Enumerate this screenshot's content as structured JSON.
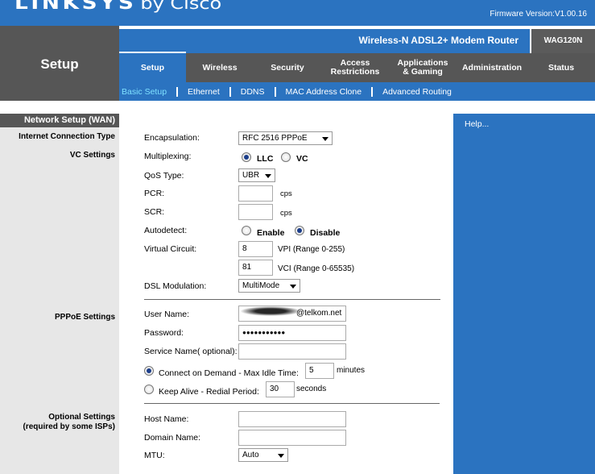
{
  "brand": {
    "logo": "LINKSYS",
    "by": "by Cisco",
    "firmware": "Firmware Version:V1.00.16"
  },
  "header": {
    "section_title": "Setup",
    "model_name": "Wireless-N ADSL2+ Modem Router",
    "model_id": "WAG120N"
  },
  "tabs": [
    {
      "label": "Setup",
      "active": true
    },
    {
      "label": "Wireless"
    },
    {
      "label": "Security"
    },
    {
      "label": "Access Restrictions"
    },
    {
      "label": "Applications & Gaming"
    },
    {
      "label": "Administration"
    },
    {
      "label": "Status"
    }
  ],
  "subnav": [
    {
      "label": "Basic Setup",
      "active": true
    },
    {
      "label": "Ethernet"
    },
    {
      "label": "DDNS"
    },
    {
      "label": "MAC Address Clone"
    },
    {
      "label": "Advanced Routing"
    }
  ],
  "left": {
    "section": "Network Setup (WAN)",
    "internet_type": "Internet Connection Type",
    "vc_settings": "VC Settings",
    "pppoe_settings": "PPPoE Settings",
    "optional_settings": "Optional Settings",
    "optional_note": "(required by some ISPs)"
  },
  "form": {
    "encapsulation": {
      "label": "Encapsulation:",
      "value": "RFC 2516 PPPoE"
    },
    "multiplexing": {
      "label": "Multiplexing:",
      "opt1": "LLC",
      "opt2": "VC",
      "selected": "LLC"
    },
    "qos": {
      "label": "QoS Type:",
      "value": "UBR"
    },
    "pcr": {
      "label": "PCR:",
      "value": "",
      "unit": "cps"
    },
    "scr": {
      "label": "SCR:",
      "value": "",
      "unit": "cps"
    },
    "autodetect": {
      "label": "Autodetect:",
      "opt1": "Enable",
      "opt2": "Disable",
      "selected": "Disable"
    },
    "virtual_circuit": {
      "label": "Virtual Circuit:",
      "vpi": "8",
      "vpi_label": "VPI (Range 0-255)",
      "vci": "81",
      "vci_label": "VCI (Range 0-65535)"
    },
    "dsl": {
      "label": "DSL Modulation:",
      "value": "MultiMode"
    },
    "username": {
      "label": "User Name:",
      "value": "@telkom.net"
    },
    "password": {
      "label": "Password:",
      "value": "●●●●●●●●●●●"
    },
    "service": {
      "label": "Service Name( optional):",
      "value": ""
    },
    "connect_on_demand": {
      "label": "Connect on Demand - Max Idle Time:",
      "value": "5",
      "unit": "minutes",
      "selected": true
    },
    "keep_alive": {
      "label": "Keep Alive - Redial Period:",
      "value": "30",
      "unit": "seconds"
    },
    "host": {
      "label": "Host Name:",
      "value": ""
    },
    "domain": {
      "label": "Domain Name:",
      "value": ""
    },
    "mtu": {
      "label": "MTU:",
      "value": "Auto"
    }
  },
  "help": {
    "link": "Help..."
  },
  "colors": {
    "blue": "#2b73c0",
    "gray": "#565656",
    "light": "#e7e7e7",
    "active_sub": "#7ee0ff"
  }
}
